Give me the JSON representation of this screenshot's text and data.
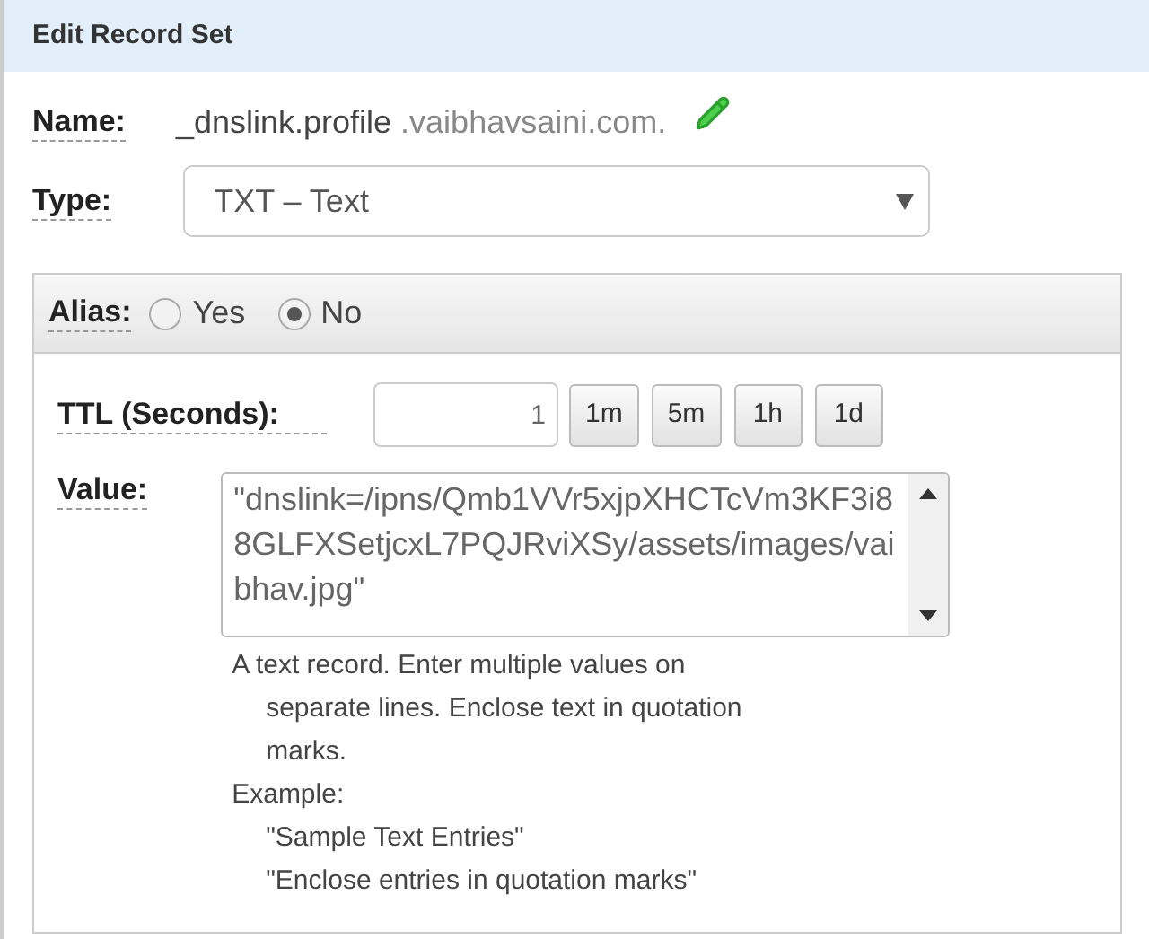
{
  "panel": {
    "title": "Edit Record Set"
  },
  "name": {
    "label": "Name:",
    "value": "_dnslink.profile",
    "domain": ".vaibhavsaini.com."
  },
  "type": {
    "label": "Type:",
    "value": "TXT – Text"
  },
  "alias": {
    "label": "Alias:",
    "options": [
      {
        "label": "Yes",
        "selected": false
      },
      {
        "label": "No",
        "selected": true
      }
    ]
  },
  "ttl": {
    "label": "TTL (Seconds):",
    "value": "1",
    "presets": [
      "1m",
      "5m",
      "1h",
      "1d"
    ]
  },
  "value": {
    "label": "Value:",
    "text": "\"dnslink=/ipns/Qmb1VVr5xjpXHCTcVm3KF3i88GLFXSetjcxL7PQJRviXSy/assets/images/vaibhav.jpg\"",
    "help": "A text record. Enter multiple values on separate lines. Enclose text in quotation marks.",
    "example_label": "Example:",
    "examples": [
      "\"Sample Text Entries\"",
      "\"Enclose entries in quotation marks\""
    ]
  }
}
